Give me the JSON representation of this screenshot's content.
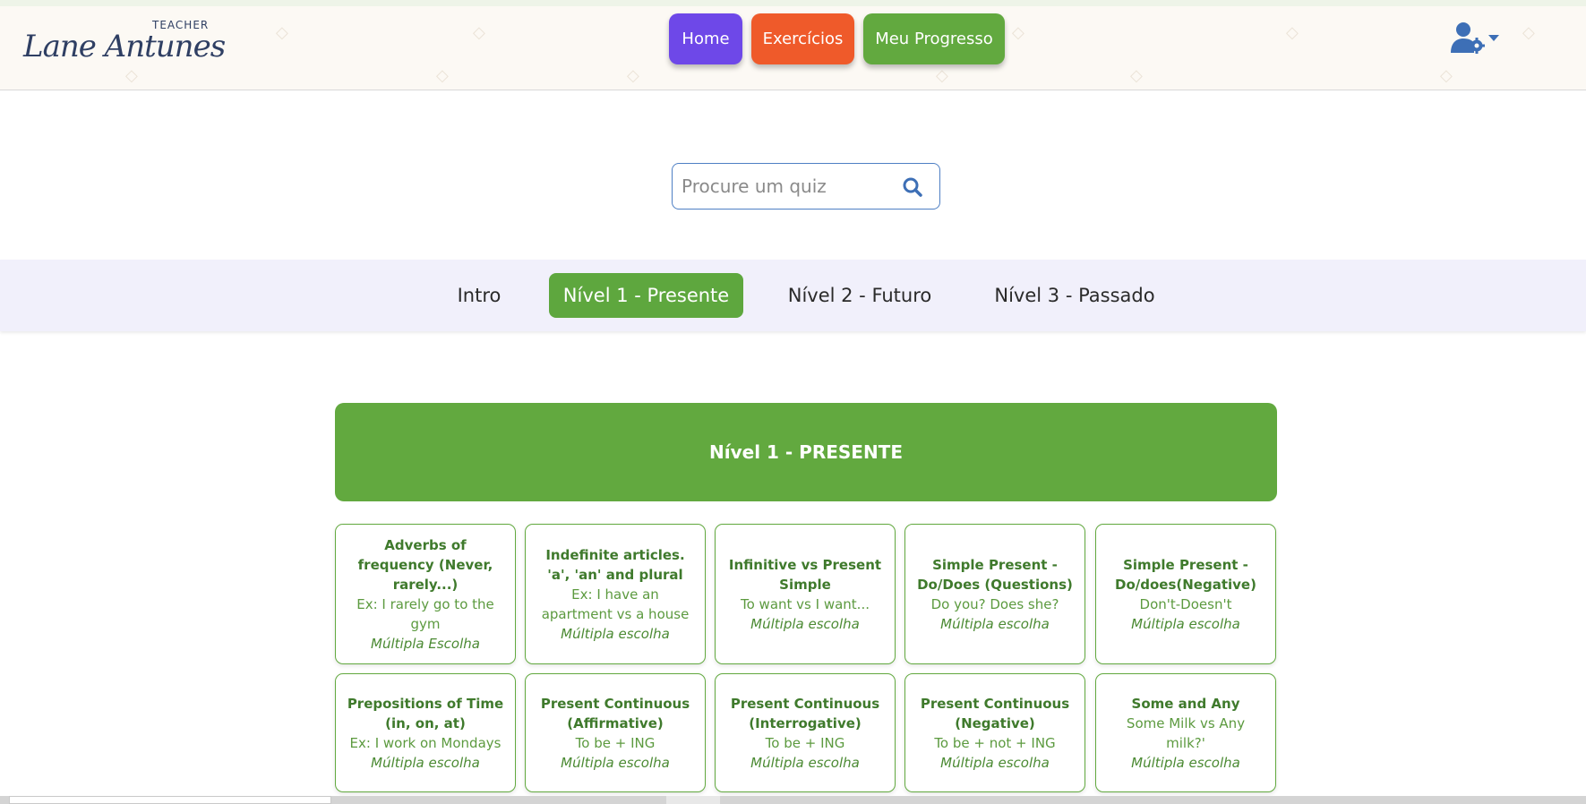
{
  "header": {
    "logo": {
      "small": "TEACHER",
      "name": "Lane Antunes"
    },
    "nav": {
      "home": "Home",
      "exercises": "Exercícios",
      "progress": "Meu Progresso"
    },
    "user_icon": "user-gear-icon",
    "colors": {
      "home": "#6e48e8",
      "exercises": "#ef5a2a",
      "progress": "#62a93f"
    }
  },
  "search": {
    "placeholder": "Procure um quiz",
    "value": "",
    "icon": "search-icon"
  },
  "tabs": [
    {
      "label": "Intro",
      "active": false
    },
    {
      "label": "Nível 1 - Presente",
      "active": true
    },
    {
      "label": "Nível 2 - Futuro",
      "active": false
    },
    {
      "label": "Nível 3 - Passado",
      "active": false
    }
  ],
  "level": {
    "title": "Nível 1 - PRESENTE",
    "color": "#62a93f"
  },
  "cards": [
    {
      "title": "Adverbs of frequency (Never, rarely...)",
      "example": "Ex: I rarely go to the gym",
      "type": "Múltipla Escolha"
    },
    {
      "title": "Indefinite articles. 'a', 'an' and plural",
      "example": "Ex: I have an apartment vs a house",
      "type": "Múltipla escolha"
    },
    {
      "title": "Infinitive vs Present Simple",
      "example": "To want vs I want...",
      "type": "Múltipla escolha"
    },
    {
      "title": "Simple Present - Do/Does (Questions)",
      "example": "Do you? Does she?",
      "type": "Múltipla escolha"
    },
    {
      "title": "Simple Present - Do/does(Negative)",
      "example": "Don't-Doesn't",
      "type": "Múltipla escolha"
    },
    {
      "title": "Prepositions of Time (in, on, at)",
      "example": "Ex: I work on Mondays",
      "type": "Múltipla escolha"
    },
    {
      "title": "Present Continuous (Affirmative)",
      "example": "To be + ING",
      "type": "Múltipla escolha"
    },
    {
      "title": "Present Continuous (Interrogative)",
      "example": "To be + ING",
      "type": "Múltipla escolha"
    },
    {
      "title": "Present Continuous (Negative)",
      "example": "To be + not + ING",
      "type": "Múltipla escolha"
    },
    {
      "title": "Some and Any",
      "example": "Some Milk vs Any milk?'",
      "type": "Múltipla escolha"
    }
  ]
}
